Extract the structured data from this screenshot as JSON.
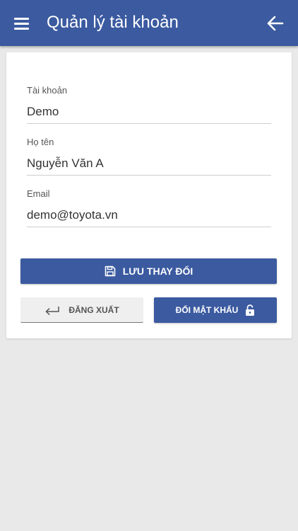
{
  "appbar": {
    "title": "Quản lý tài khoản",
    "menu_icon": "hamburger-menu-icon",
    "back_icon": "arrow-left-icon",
    "color": "#3b5aa0"
  },
  "form": {
    "account": {
      "label": "Tài khoản",
      "value": "Demo"
    },
    "full_name": {
      "label": "Họ tên",
      "value": "Nguyễn Văn A"
    },
    "email": {
      "label": "Email",
      "value": "demo@toyota.vn"
    }
  },
  "actions": {
    "save_label": "LƯU THAY ĐỔI",
    "save_icon": "floppy-disk-icon",
    "logout_label": "ĐĂNG XUẤT",
    "logout_icon": "return-arrow-icon",
    "change_password_label": "ĐỔI MẬT KHẨU",
    "change_password_icon": "lock-icon"
  },
  "colors": {
    "primary": "#3b5aa0",
    "background": "#e9e9e9",
    "card": "#ffffff"
  }
}
